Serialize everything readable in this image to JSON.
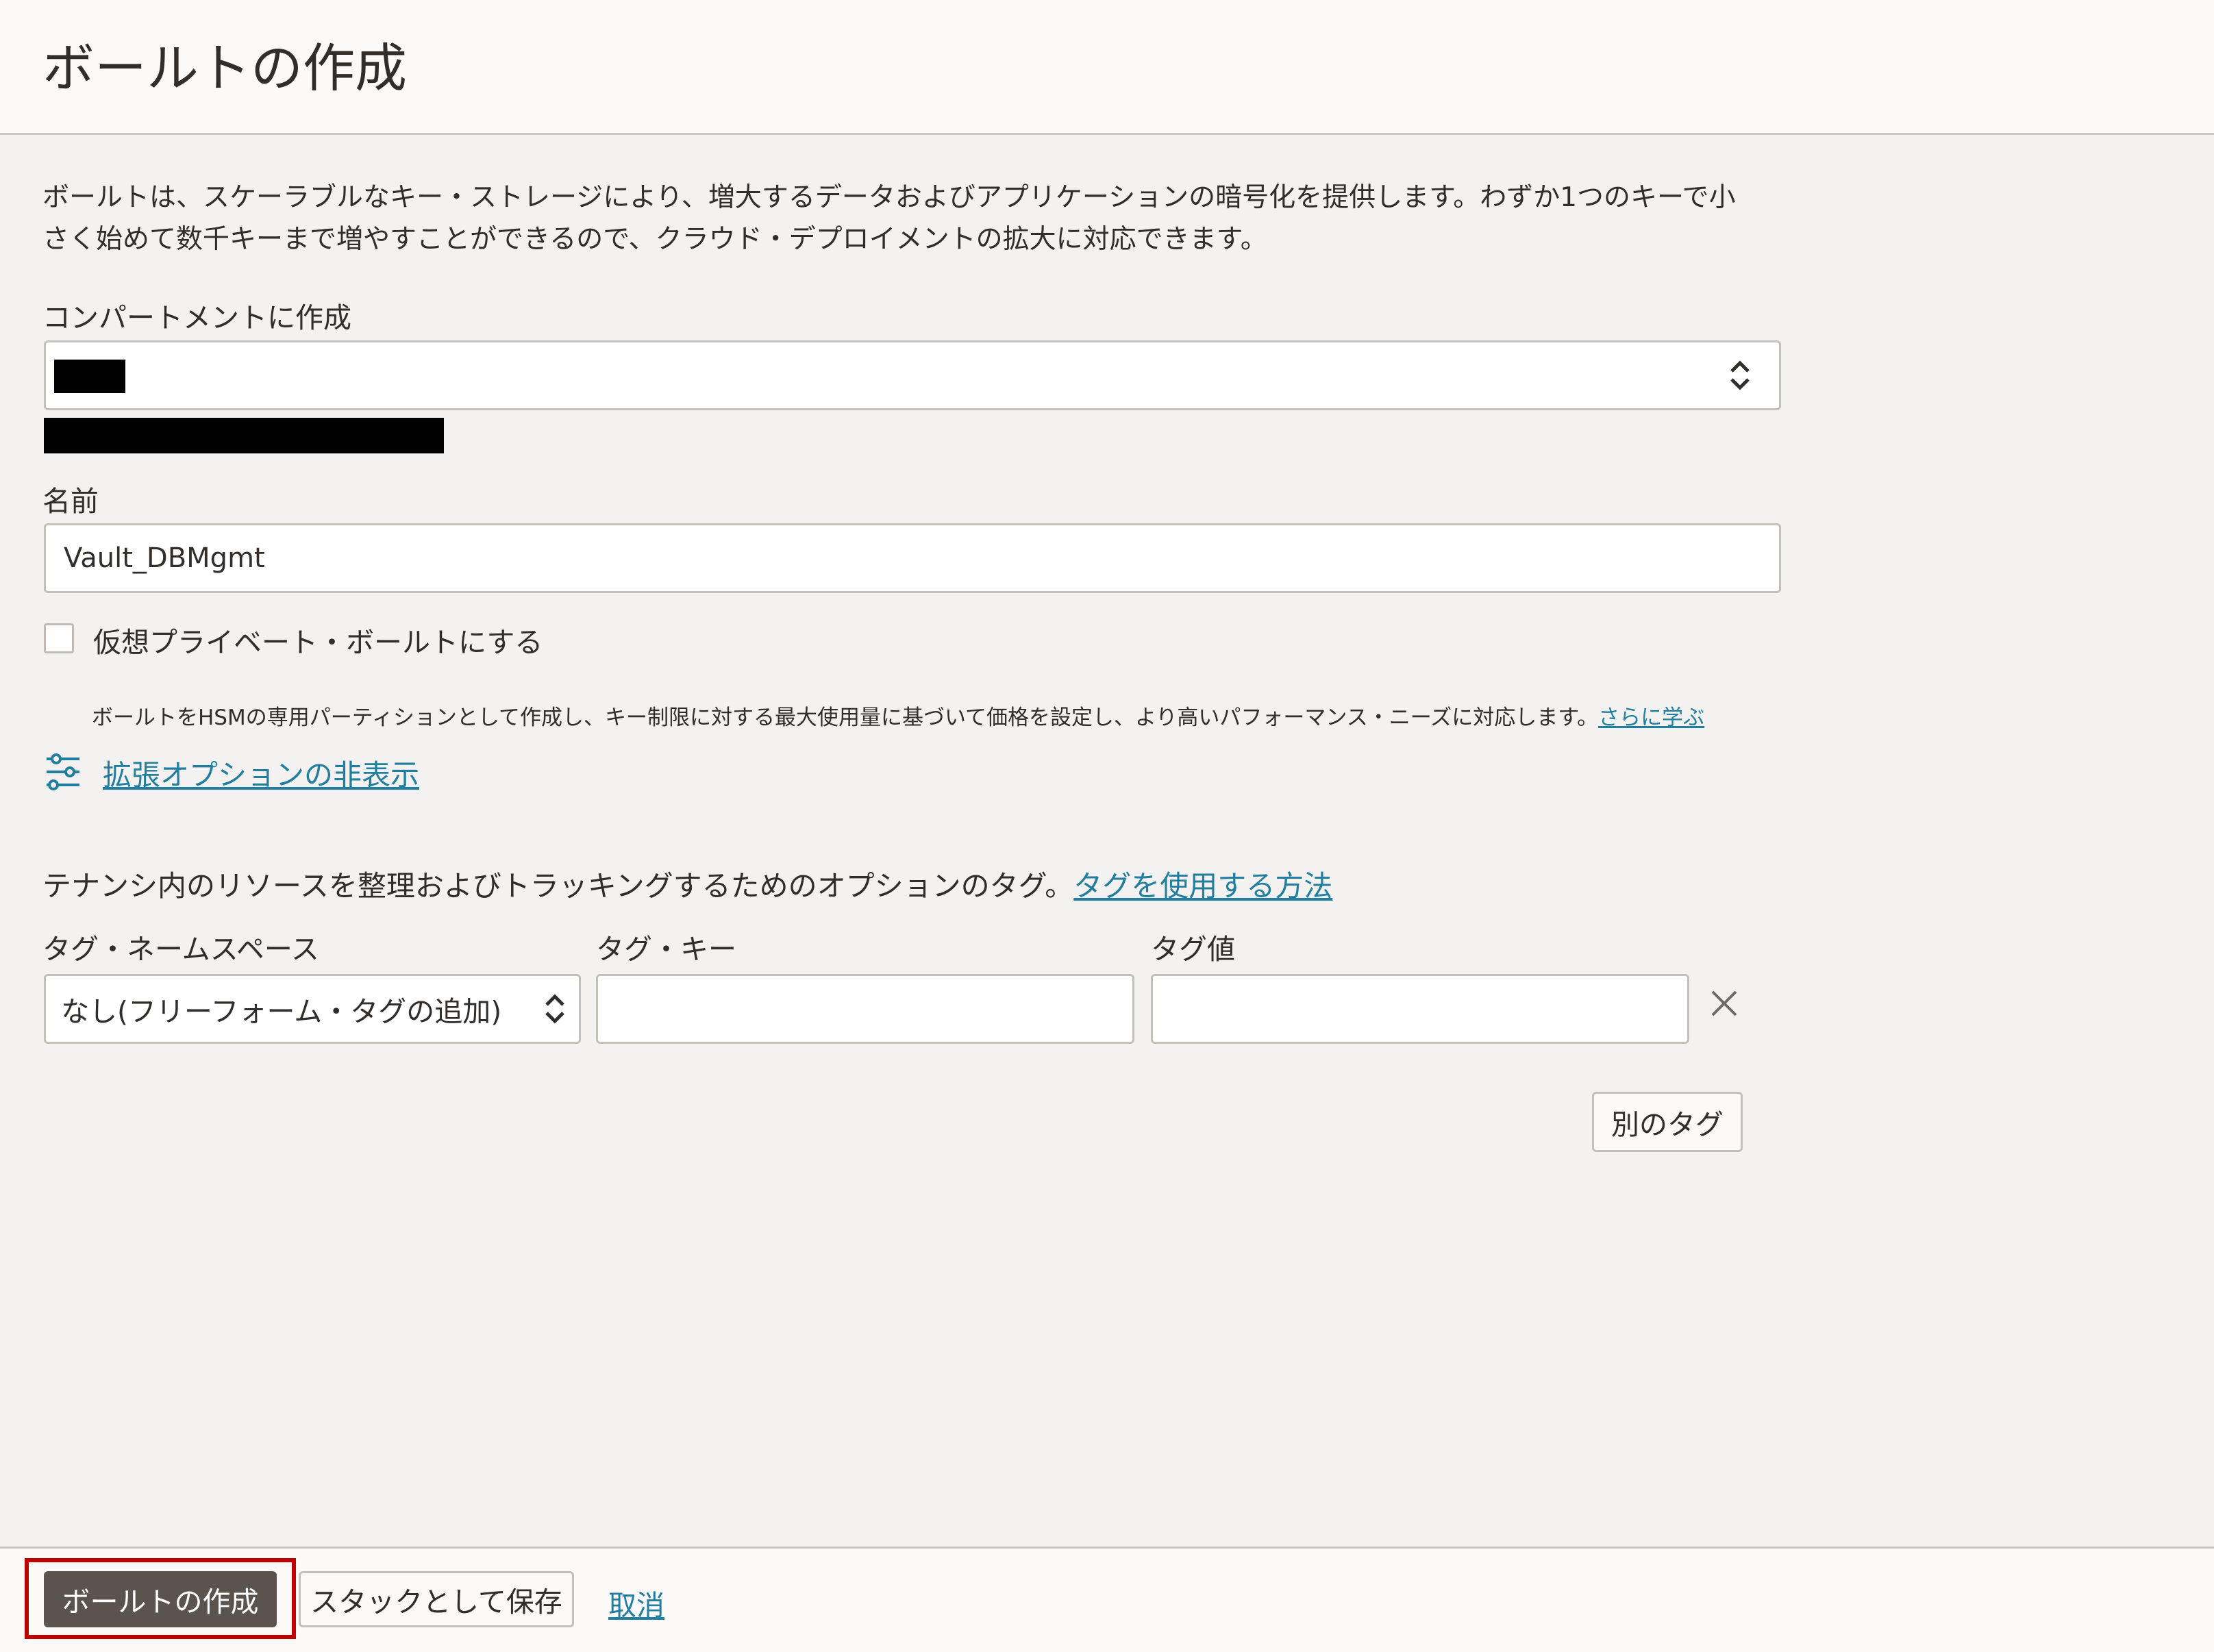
{
  "header": {
    "title": "ボールトの作成"
  },
  "description": {
    "line1": "ボールトは、スケーラブルなキー・ストレージにより、増大するデータおよびアプリケーションの暗号化を提供します。わずか1つのキーで小",
    "line2": "さく始めて数千キーまで増やすことができるので、クラウド・デプロイメントの拡大に対応できます。"
  },
  "compartment": {
    "label": "コンパートメントに作成",
    "value_redacted": true,
    "path_redacted": true
  },
  "name_field": {
    "label": "名前",
    "value": "Vault_DBMgmt"
  },
  "virtual_private": {
    "checkbox_label": "仮想プライベート・ボールトにする",
    "checked": false,
    "help_text": "ボールトをHSMの専用パーティションとして作成し、キー制限に対する最大使用量に基づいて価格を設定し、より高いパフォーマンス・ニーズに対応します。",
    "learn_more": "さらに学ぶ"
  },
  "advanced": {
    "link_label": "拡張オプションの非表示",
    "icon": "sliders-icon"
  },
  "tags": {
    "intro": "テナンシ内のリソースを整理およびトラッキングするためのオプションのタグ。",
    "how_to_link": "タグを使用する方法",
    "namespace_label": "タグ・ネームスペース",
    "namespace_value": "なし(フリーフォーム・タグの追加)",
    "key_label": "タグ・キー",
    "key_value": "",
    "value_label": "タグ値",
    "value_value": "",
    "remove_icon": "close-icon",
    "add_button": "別のタグ"
  },
  "footer": {
    "create_button": "ボールトの作成",
    "stack_button": "スタックとして保存",
    "cancel_link": "取消",
    "highlight_color": "#c00000",
    "primary_color": "#5b534e",
    "link_color": "#227e9e"
  }
}
